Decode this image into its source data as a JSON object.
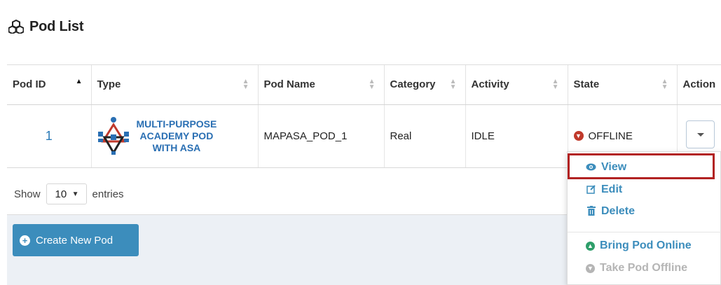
{
  "panel": {
    "title": "Pod List",
    "title_icon": "cubes-icon"
  },
  "table": {
    "columns": [
      "Pod ID",
      "Type",
      "Pod Name",
      "Category",
      "Activity",
      "State",
      "Action"
    ],
    "rows": [
      {
        "pod_id": "1",
        "type_lines": [
          "MULTI-PURPOSE",
          "ACADEMY POD",
          "WITH ASA"
        ],
        "pod_name": "MAPASA_POD_1",
        "category": "Real",
        "activity": "IDLE",
        "state": "OFFLINE"
      }
    ]
  },
  "length_menu": {
    "prefix": "Show",
    "value": "10",
    "suffix": "entries"
  },
  "create_button": {
    "label": "Create New Pod"
  },
  "action_menu": {
    "items": [
      {
        "label": "View",
        "icon": "eye-icon"
      },
      {
        "label": "Edit",
        "icon": "edit-icon"
      },
      {
        "label": "Delete",
        "icon": "trash-icon"
      },
      {
        "label": "Bring Pod Online",
        "icon": "arrow-up-circle-icon"
      },
      {
        "label": "Take Pod Offline",
        "icon": "arrow-down-circle-icon",
        "disabled": true
      }
    ]
  },
  "colors": {
    "accent": "#3c8dbc",
    "offline": "#c0392b",
    "highlight": "#b22222"
  }
}
